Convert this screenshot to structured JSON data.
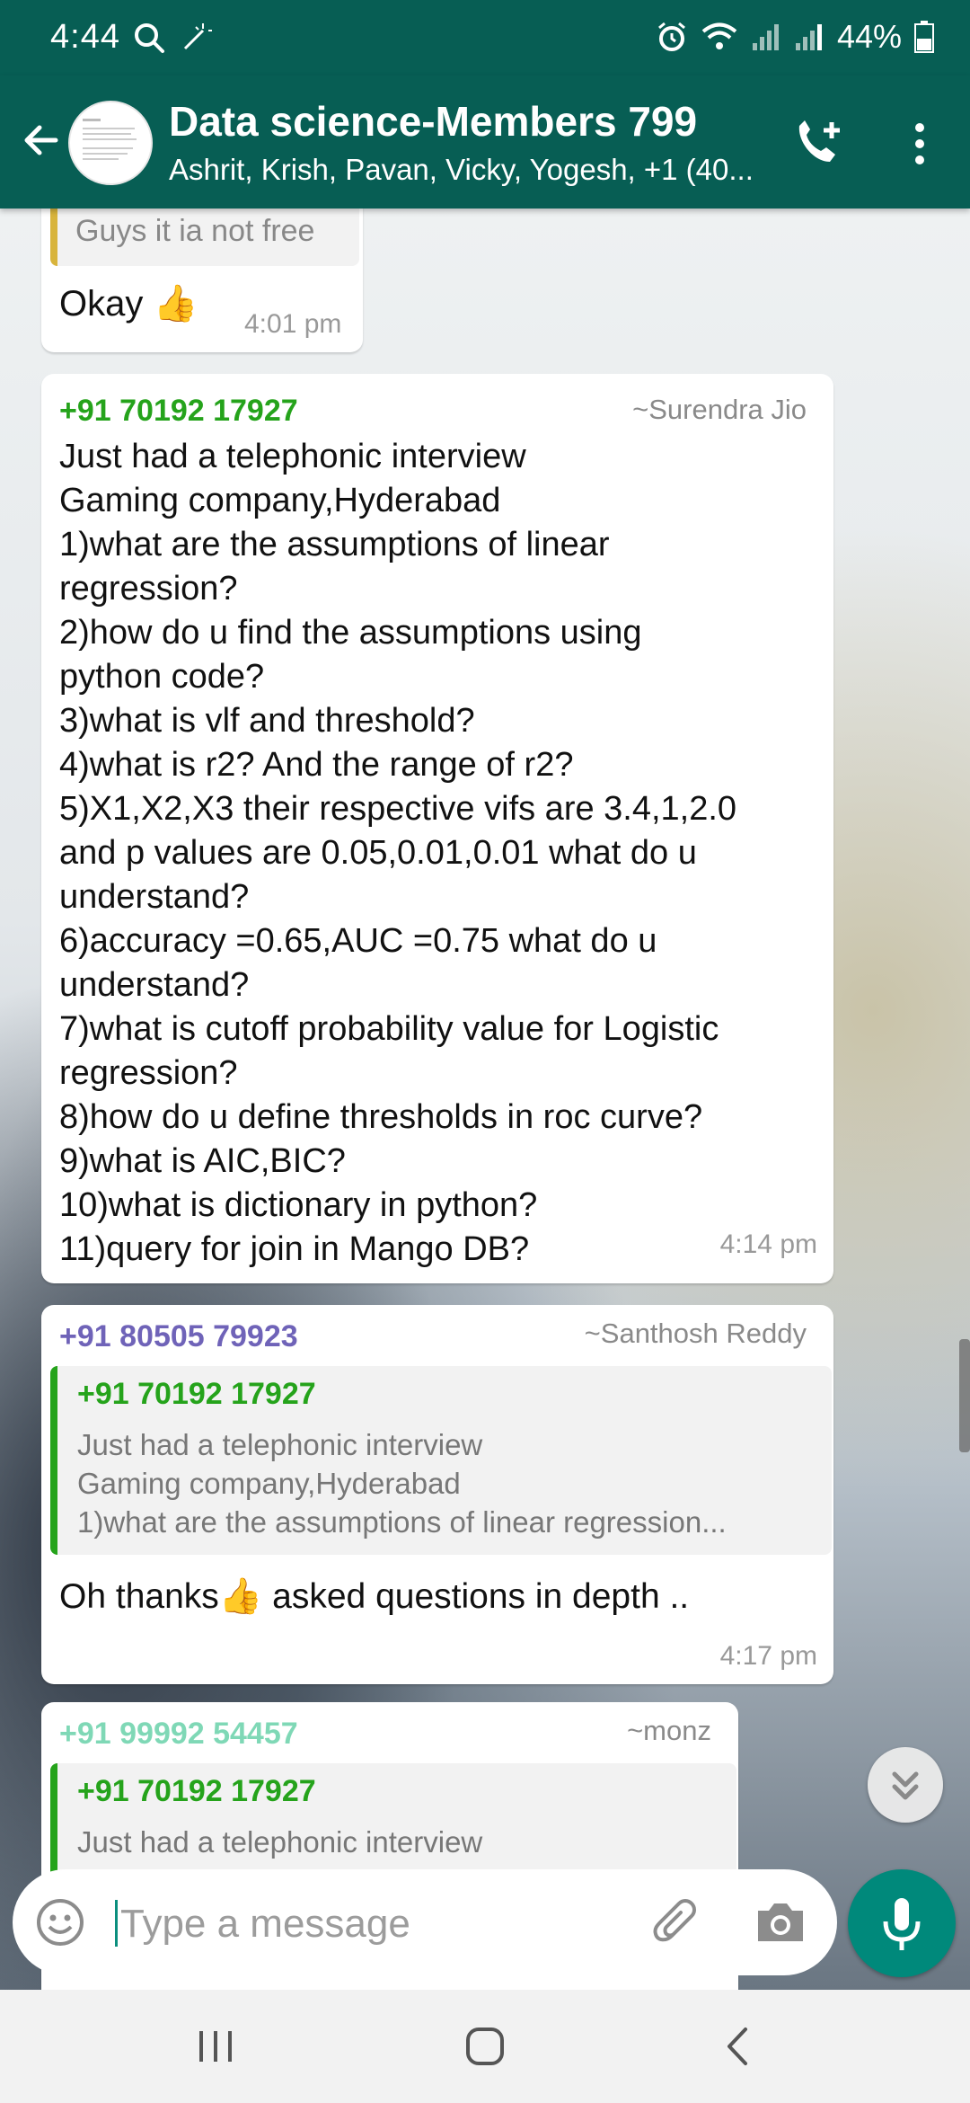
{
  "status_bar": {
    "time": "4:44",
    "battery": "44%",
    "icons": [
      "search-icon",
      "magic-wand-icon",
      "alarm-icon",
      "wifi-icon",
      "signal-icon",
      "signal-icon",
      "battery-icon"
    ]
  },
  "header": {
    "title": "Data science-Members 799",
    "subtitle": "Ashrit, Krish, Pavan, Vicky, Yogesh, +1 (40...",
    "icons": [
      "back-arrow-icon",
      "group-avatar",
      "add-call-icon",
      "more-vert-icon"
    ]
  },
  "colors": {
    "header_bg": "#075e54",
    "sender_green": "#25a31b",
    "sender_purple": "#6f63b8",
    "sender_mint": "#7fd8b6",
    "mic_button": "#00897b"
  },
  "messages": [
    {
      "quote_fragment": "Guys it ia not free",
      "text": "Okay 👍",
      "time": "4:01 pm"
    },
    {
      "sender": "+91 70192 17927",
      "pushname": "~Surendra Jio",
      "text": "Just had a telephonic interview\nGaming company,Hyderabad\n1)what are the assumptions of linear\nregression?\n2)how do u find the assumptions using\npython code?\n3)what is vlf and threshold?\n4)what is r2? And the range of r2?\n5)X1,X2,X3 their respective vifs are 3.4,1,2.0\nand p values are 0.05,0.01,0.01 what do u\nunderstand?\n6)accuracy =0.65,AUC =0.75 what do u\nunderstand?\n7)what is cutoff probability value for Logistic\nregression?\n8)how do u define thresholds in roc curve?\n9)what is AIC,BIC?\n10)what is dictionary in python?\n11)query for join in Mango DB?",
      "time": "4:14 pm"
    },
    {
      "sender": "+91 80505 79923",
      "pushname": "~Santhosh Reddy",
      "quote": {
        "sender": "+91 70192 17927",
        "text": "Just had a telephonic interview\nGaming company,Hyderabad\n1)what are the assumptions of linear regression..."
      },
      "text": "Oh thanks👍 asked questions in depth ..",
      "time": "4:17 pm"
    },
    {
      "sender": "+91 99992 54457",
      "pushname": "~monz",
      "quote": {
        "sender": "+91 70192 17927",
        "text": "Just had a telephonic interview"
      }
    }
  ],
  "composer": {
    "placeholder": "Type a message",
    "icons": [
      "emoji-icon",
      "attach-icon",
      "camera-icon",
      "mic-icon"
    ]
  },
  "nav_bar": {
    "icons": [
      "recent-apps-icon",
      "home-icon",
      "back-icon"
    ]
  }
}
